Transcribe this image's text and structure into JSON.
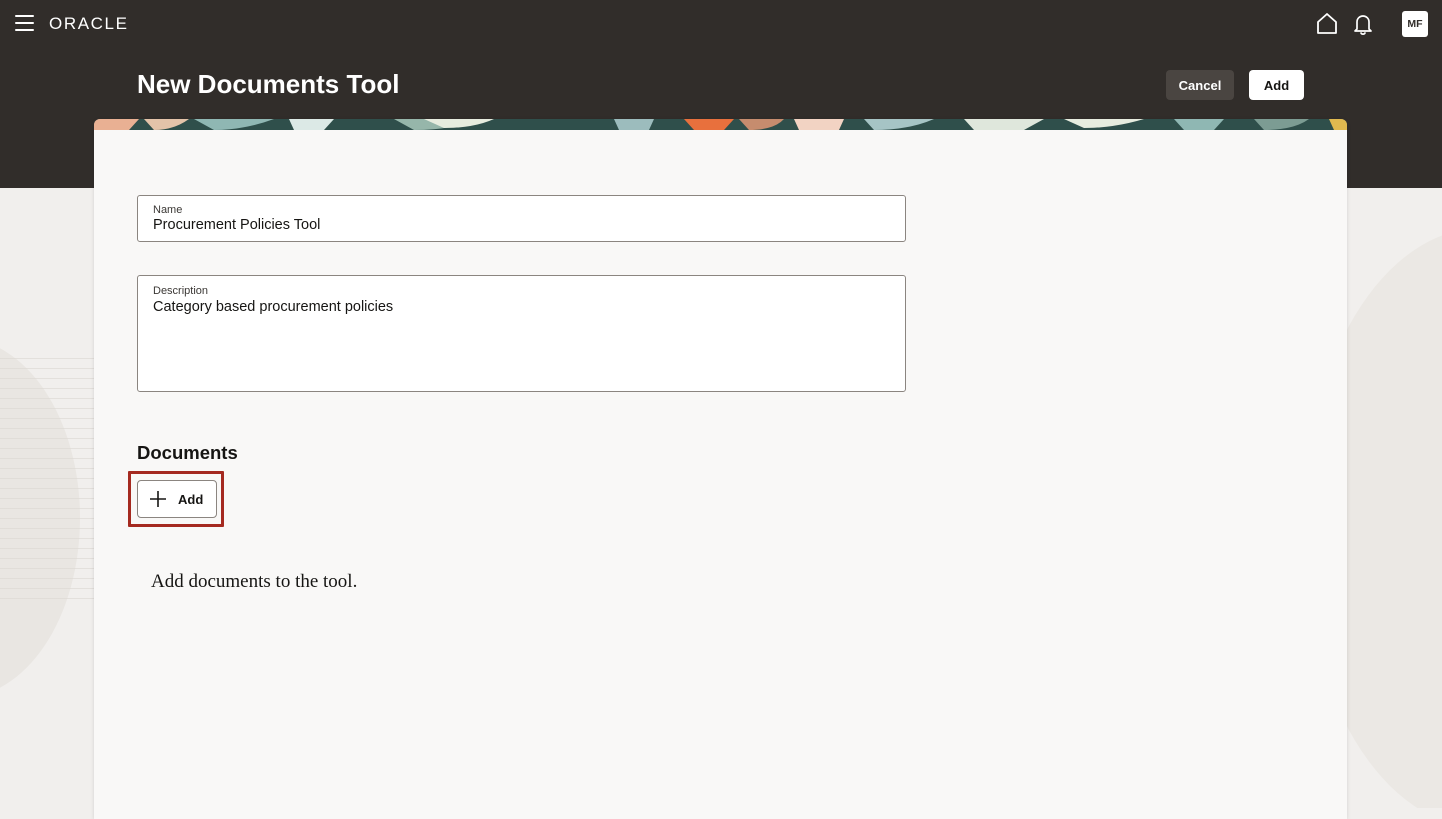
{
  "app": {
    "brand": "ORACLE",
    "avatar_initials": "MF",
    "icons": {
      "menu": "hamburger-menu-icon",
      "home": "home-icon",
      "notifications": "bell-icon",
      "add": "plus-icon"
    }
  },
  "header": {
    "title": "New Documents Tool",
    "cancel_label": "Cancel",
    "add_label": "Add"
  },
  "form": {
    "name": {
      "label": "Name",
      "value": "Procurement Policies Tool"
    },
    "description": {
      "label": "Description",
      "value": "Category based procurement policies"
    }
  },
  "documents": {
    "title": "Documents",
    "add_label": "Add",
    "empty_message": "Add documents to the tool."
  },
  "colors": {
    "header_bg": "#312d2a",
    "page_bg": "#f1efed",
    "card_bg": "#f9f8f7",
    "highlight": "#a52a20"
  }
}
